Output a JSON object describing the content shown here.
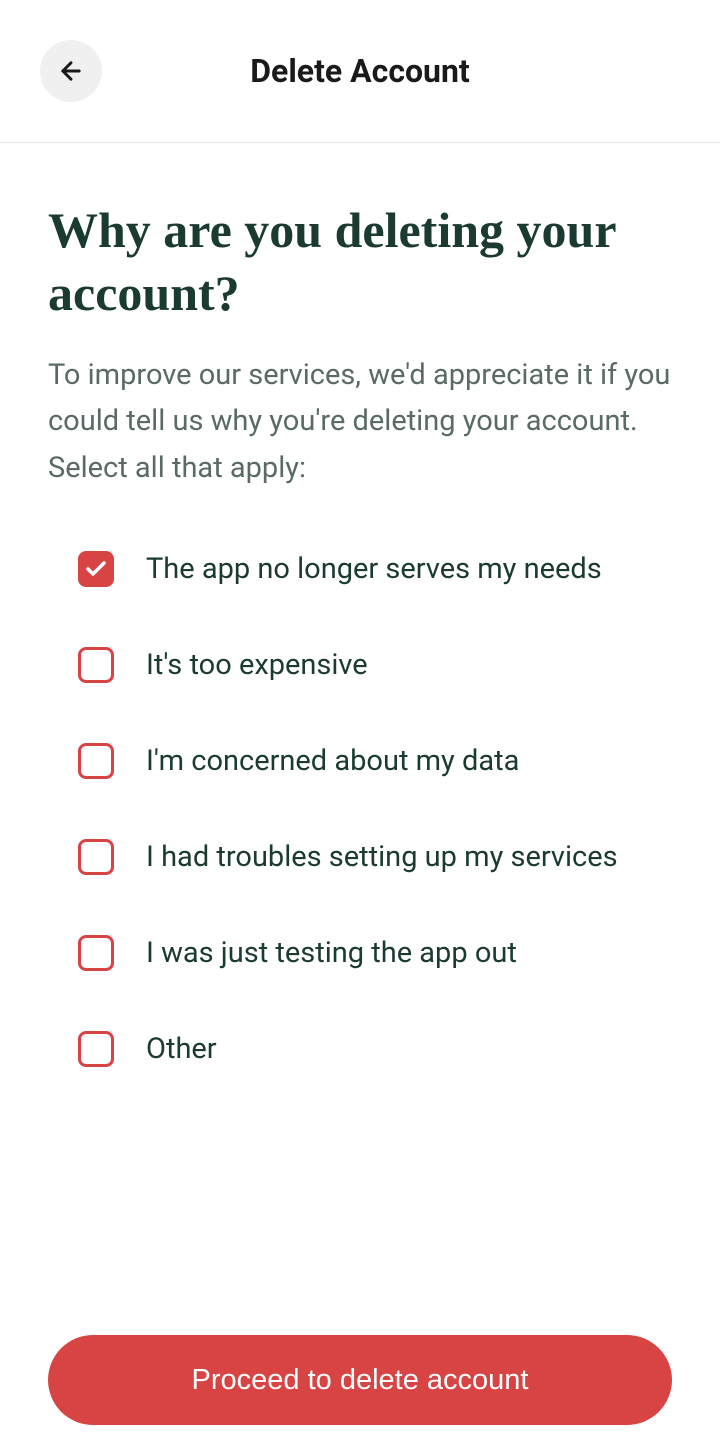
{
  "header": {
    "title": "Delete Account"
  },
  "main": {
    "heading": "Why are you deleting your account?",
    "description": "To improve our services, we'd appreciate it if you could tell us why you're deleting your account. Select all that apply:",
    "reasons": [
      {
        "label": "The app no longer serves my needs",
        "checked": true
      },
      {
        "label": "It's too expensive",
        "checked": false
      },
      {
        "label": "I'm concerned about my data",
        "checked": false
      },
      {
        "label": "I had troubles setting up my services",
        "checked": false
      },
      {
        "label": "I was just testing the app out",
        "checked": false
      },
      {
        "label": "Other",
        "checked": false
      }
    ],
    "proceed_label": "Proceed to delete account"
  }
}
